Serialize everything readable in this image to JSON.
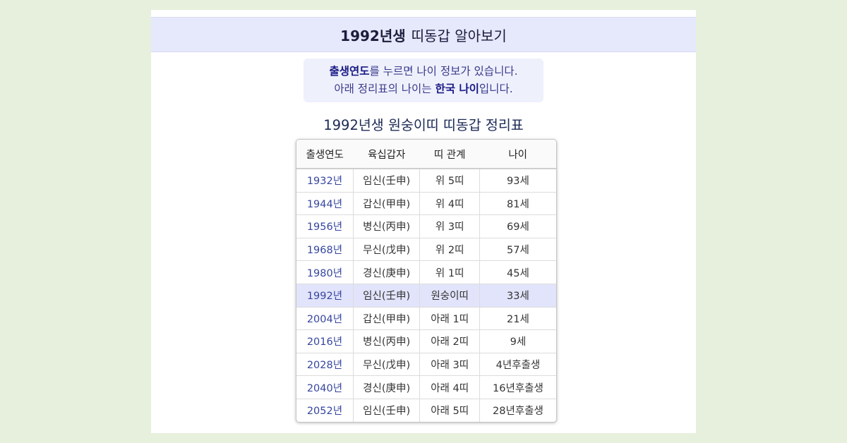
{
  "header": {
    "title_bold": "1992년생",
    "title_rest": "띠동갑 알아보기"
  },
  "notice": {
    "line1_bold": "출생연도",
    "line1_rest": "를 누르면 나이 정보가 있습니다.",
    "line2_pre": "아래 정리표의 나이는 ",
    "line2_bold": "한국 나이",
    "line2_post": "입니다."
  },
  "table": {
    "title": "1992년생 원숭이띠 띠동갑 정리표",
    "columns": [
      "출생연도",
      "육십갑자",
      "띠 관계",
      "나이"
    ],
    "rows": [
      {
        "year": "1932년",
        "ganji": "임신(壬申)",
        "relation": "위 5띠",
        "age": "93세"
      },
      {
        "year": "1944년",
        "ganji": "갑신(甲申)",
        "relation": "위 4띠",
        "age": "81세"
      },
      {
        "year": "1956년",
        "ganji": "병신(丙申)",
        "relation": "위 3띠",
        "age": "69세"
      },
      {
        "year": "1968년",
        "ganji": "무신(戊申)",
        "relation": "위 2띠",
        "age": "57세"
      },
      {
        "year": "1980년",
        "ganji": "경신(庚申)",
        "relation": "위 1띠",
        "age": "45세"
      },
      {
        "year": "1992년",
        "ganji": "임신(壬申)",
        "relation": "원숭이띠",
        "age": "33세"
      },
      {
        "year": "2004년",
        "ganji": "갑신(甲申)",
        "relation": "아래 1띠",
        "age": "21세"
      },
      {
        "year": "2016년",
        "ganji": "병신(丙申)",
        "relation": "아래 2띠",
        "age": "9세"
      },
      {
        "year": "2028년",
        "ganji": "무신(戊申)",
        "relation": "아래 3띠",
        "age": "4년후출생"
      },
      {
        "year": "2040년",
        "ganji": "경신(庚申)",
        "relation": "아래 4띠",
        "age": "16년후출생"
      },
      {
        "year": "2052년",
        "ganji": "임신(壬申)",
        "relation": "아래 5띠",
        "age": "28년후출생"
      }
    ]
  },
  "colors": {
    "background": "#e6f0dc",
    "header_bg": "#e6e8fc",
    "highlight_row": "#e2e4fb",
    "year_link": "#3646a0"
  }
}
